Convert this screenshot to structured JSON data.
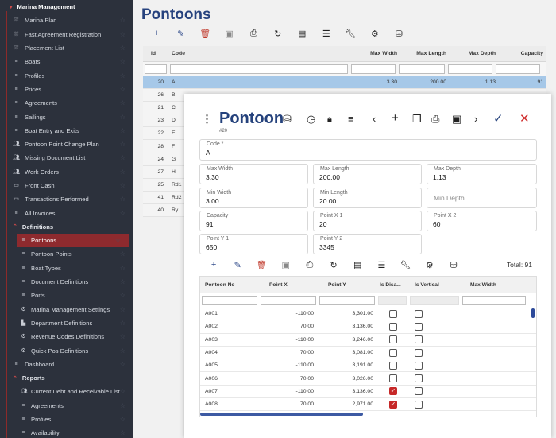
{
  "sidebar": {
    "header": "Marina Management",
    "items": [
      {
        "label": "Marina Plan",
        "icon": "map-icon"
      },
      {
        "label": "Fast Agreement Registration",
        "icon": "map-icon"
      },
      {
        "label": "Placement List",
        "icon": "map-icon"
      },
      {
        "label": "Boats",
        "icon": "list-icon"
      },
      {
        "label": "Profiles",
        "icon": "list-icon"
      },
      {
        "label": "Prices",
        "icon": "list-icon"
      },
      {
        "label": "Agreements",
        "icon": "list-icon"
      },
      {
        "label": "Sailings",
        "icon": "list-icon"
      },
      {
        "label": "Boat Entry and Exits",
        "icon": "list-icon"
      },
      {
        "label": "Pontoon Point Change Plan",
        "icon": "users-icon"
      },
      {
        "label": "Missing Document List",
        "icon": "users-icon"
      },
      {
        "label": "Work Orders",
        "icon": "users-icon"
      },
      {
        "label": "Front Cash",
        "icon": "card-icon"
      },
      {
        "label": "Transactions Performed",
        "icon": "card-icon"
      },
      {
        "label": "All Invoices",
        "icon": "list-icon"
      }
    ],
    "definitions": {
      "label": "Definitions",
      "items": [
        {
          "label": "Pontoons",
          "icon": "list-icon",
          "active": true
        },
        {
          "label": "Pontoon Points",
          "icon": "list-icon"
        },
        {
          "label": "Boat Types",
          "icon": "list-icon"
        },
        {
          "label": "Document Definitions",
          "icon": "list-icon"
        },
        {
          "label": "Ports",
          "icon": "list-icon"
        },
        {
          "label": "Marina Management Settings",
          "icon": "gear-icon"
        },
        {
          "label": "Department Definitions",
          "icon": "building-icon"
        },
        {
          "label": "Revenue Codes Definitions",
          "icon": "gear-icon"
        },
        {
          "label": "Quick Pos Definitions",
          "icon": "gear-icon"
        }
      ]
    },
    "dashboard": "Dashboard",
    "reports": {
      "label": "Reports",
      "items": [
        {
          "label": "Current Debt and Receivable List",
          "icon": "users-icon"
        },
        {
          "label": "Agreements",
          "icon": "list-icon"
        },
        {
          "label": "Profiles",
          "icon": "list-icon"
        },
        {
          "label": "Availability",
          "icon": "list-icon"
        }
      ]
    }
  },
  "page": {
    "title": "Pontoons"
  },
  "grid": {
    "headers": {
      "id": "Id",
      "code": "Code",
      "max_width": "Max Width",
      "max_length": "Max Length",
      "max_depth": "Max Depth",
      "capacity": "Capacity"
    },
    "rows": [
      {
        "id": "20",
        "code": "A",
        "mw": "3.30",
        "ml": "200.00",
        "md": "1.13",
        "cap": "91",
        "selected": true
      },
      {
        "id": "26",
        "code": "B"
      },
      {
        "id": "21",
        "code": "C"
      },
      {
        "id": "23",
        "code": "D"
      },
      {
        "id": "22",
        "code": "E"
      },
      {
        "id": "28",
        "code": "F"
      },
      {
        "id": "24",
        "code": "G"
      },
      {
        "id": "27",
        "code": "H"
      },
      {
        "id": "25",
        "code": "Rd1"
      },
      {
        "id": "41",
        "code": "Rd2"
      },
      {
        "id": "40",
        "code": "Ry"
      }
    ]
  },
  "modal": {
    "title": "Pontoon",
    "record_id": "#20",
    "fields": {
      "code": {
        "label": "Code *",
        "value": "A"
      },
      "max_width": {
        "label": "Max Width",
        "value": "3.30"
      },
      "max_length": {
        "label": "Max Length",
        "value": "200.00"
      },
      "max_depth": {
        "label": "Max Depth",
        "value": "1.13"
      },
      "min_width": {
        "label": "Min Width",
        "value": "3.00"
      },
      "min_length": {
        "label": "Min Length",
        "value": "20.00"
      },
      "min_depth": {
        "placeholder": "Min Depth"
      },
      "capacity": {
        "label": "Capacity",
        "value": "91"
      },
      "point_x1": {
        "label": "Point X 1",
        "value": "20"
      },
      "point_x2": {
        "label": "Point X 2",
        "value": "60"
      },
      "point_y1": {
        "label": "Point Y 1",
        "value": "650"
      },
      "point_y2": {
        "label": "Point Y 2",
        "value": "3345"
      }
    },
    "total": "Total: 91",
    "points_table": {
      "headers": {
        "no": "Pontoon No",
        "x": "Point X",
        "y": "Point Y",
        "dis": "Is Disa...",
        "ver": "Is Vertical",
        "mw": "Max Width"
      },
      "rows": [
        {
          "no": "A001",
          "x": "-110.00",
          "y": "3,301.00",
          "dis": false,
          "ver": false
        },
        {
          "no": "A002",
          "x": "70.00",
          "y": "3,136.00",
          "dis": false,
          "ver": false
        },
        {
          "no": "A003",
          "x": "-110.00",
          "y": "3,246.00",
          "dis": false,
          "ver": false
        },
        {
          "no": "A004",
          "x": "70.00",
          "y": "3,081.00",
          "dis": false,
          "ver": false
        },
        {
          "no": "A005",
          "x": "-110.00",
          "y": "3,191.00",
          "dis": false,
          "ver": false
        },
        {
          "no": "A006",
          "x": "70.00",
          "y": "3,026.00",
          "dis": false,
          "ver": false
        },
        {
          "no": "A007",
          "x": "-110.00",
          "y": "3,136.00",
          "dis": true,
          "ver": false
        },
        {
          "no": "A008",
          "x": "70.00",
          "y": "2,971.00",
          "dis": true,
          "ver": false
        }
      ]
    }
  }
}
